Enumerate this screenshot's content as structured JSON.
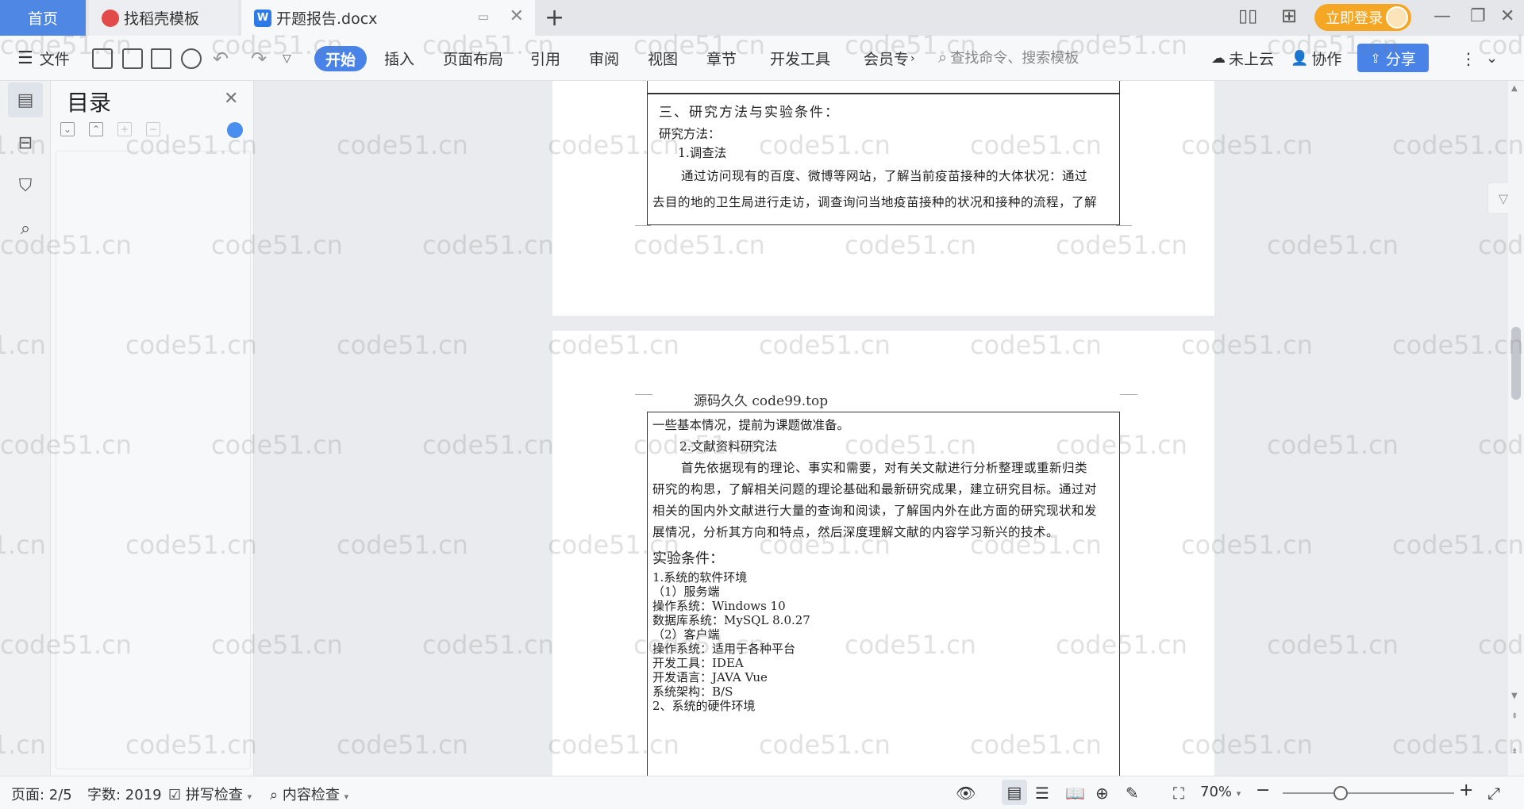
{
  "tabs": {
    "home": "首页",
    "template": "找稻壳模板",
    "document": "开题报告.docx",
    "login": "立即登录"
  },
  "ribbon": {
    "file": "文件",
    "start": "开始",
    "insert": "插入",
    "layout": "页面布局",
    "reference": "引用",
    "review": "审阅",
    "view": "视图",
    "chapter": "章节",
    "dev": "开发工具",
    "member": "会员专",
    "search_placeholder": "查找命令、搜索模板",
    "cloud": "未上云",
    "collab": "协作",
    "share": "分享"
  },
  "toc": {
    "title": "目录"
  },
  "page1": {
    "heading": "三、研究方法与实验条件：",
    "method_label": "研究方法：",
    "item1": "1.调查法",
    "para_line1": "通过访问现有的百度、微博等网站，了解当前疫苗接种的大体状况：通过",
    "para_line2": "去目的地的卫生局进行走访，调查询问当地疫苗接种的状况和接种的流程，了解"
  },
  "page2": {
    "header_text": "源码久久 code99.top",
    "line_cont": "一些基本情况，提前为课题做准备。",
    "item2": "2.文献资料研究法",
    "para2_l1": "首先依据现有的理论、事实和需要，对有关文献进行分析整理或重新归类",
    "para2_l2": "研究的构思，了解相关问题的理论基础和最新研究成果，建立研究目标。通过对",
    "para2_l3": "相关的国内外文献进行大量的查询和阅读，了解国内外在此方面的研究现状和发",
    "para2_l4": "展情况，分析其方向和特点，然后深度理解文献的内容学习新兴的技术。",
    "exp_heading": "实验条件：",
    "sw_env": "1.系统的软件环境",
    "server": "（1）服务端",
    "os": "操作系统：Windows 10",
    "db": "数据库系统：MySQL 8.0.27",
    "client": "（2）客户端",
    "os2": "操作系统：适用于各种平台",
    "ide": "开发工具：IDEA",
    "lang": "开发语言：JAVA Vue",
    "arch": "系统架构：B/S",
    "hw_env": "2、系统的硬件环境"
  },
  "status": {
    "page": "页面: 2/5",
    "words": "字数: 2019",
    "spell": "拼写检查",
    "content_check": "内容检查",
    "zoom": "70%"
  },
  "watermark": "code51.cn",
  "colors": {
    "accent": "#4a83e8",
    "login": "#f5a623",
    "home_tab": "#4f88e4"
  }
}
